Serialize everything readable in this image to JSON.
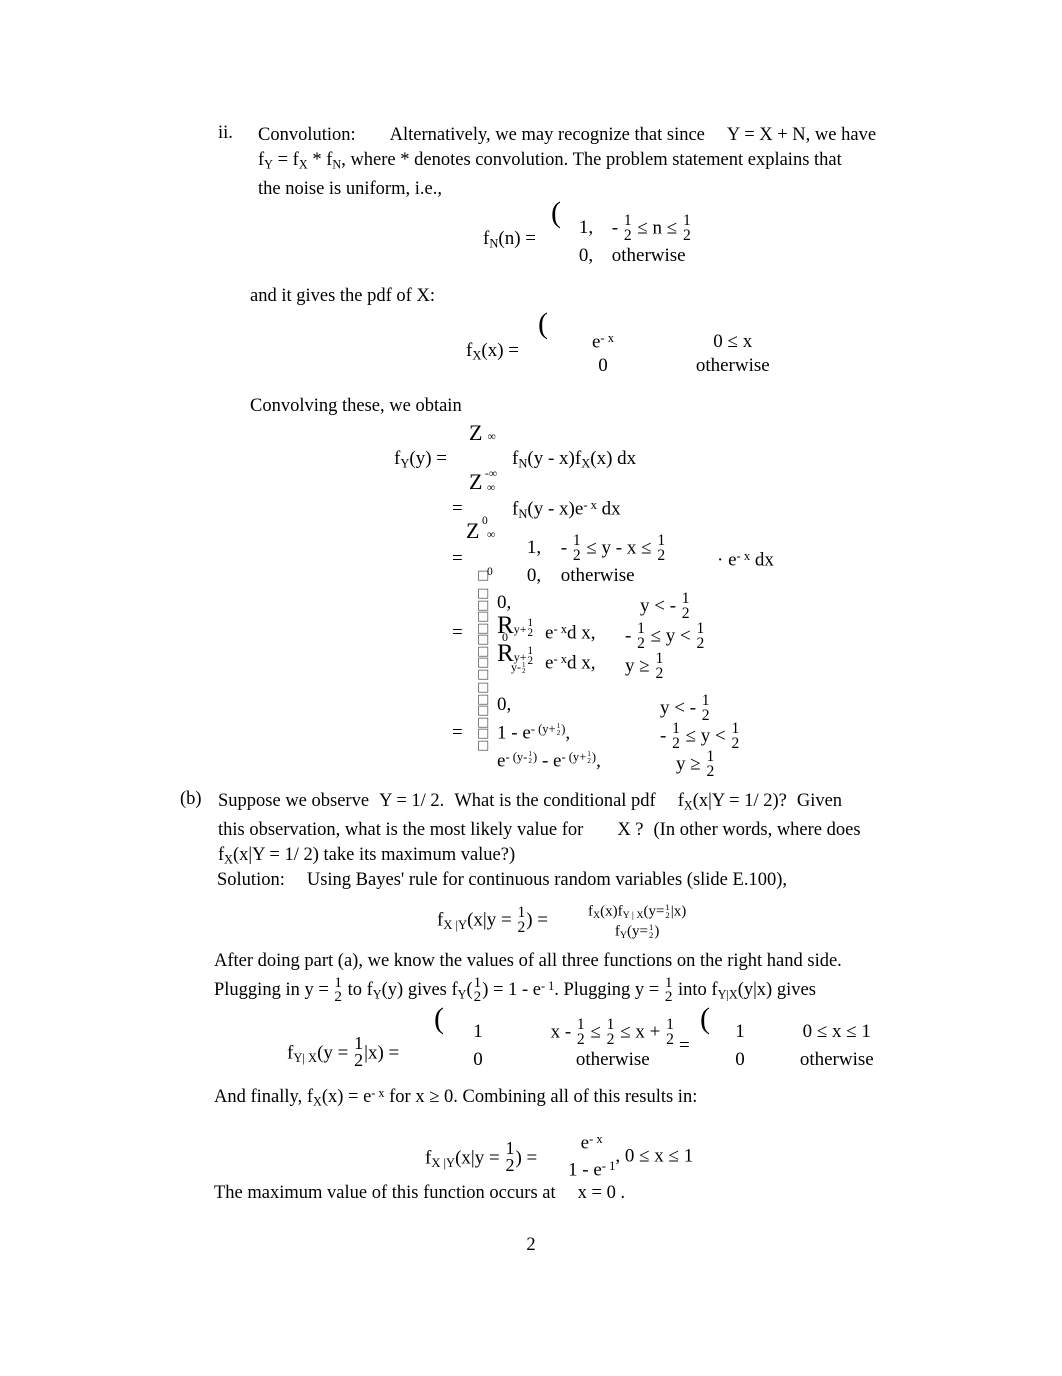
{
  "document": {
    "page_number": "2",
    "item_ii": {
      "marker": "ii.",
      "title": "Convolution:",
      "para": {
        "seg1": "Alternatively, we may recognize that since",
        "eq_Y": "Y = X + N",
        "seg2": ", we have",
        "f_Y": "f",
        "f_Y_sub": "Y",
        "eq_mid": "= f",
        "fX_sub": "X",
        "star": "* f",
        "fN_sub": "N",
        "seg3": ", where * denotes convolution. The problem statement explains that",
        "seg4": "the noise is uniform, i.e.,"
      }
    },
    "eq_fN": {
      "lhs_f": "f",
      "lhs_sub": "N",
      "lhs_arg": "(n) =",
      "brace": "(",
      "row1_val": "1,",
      "row1_cond_pre": "-",
      "row1_frac_n": "1",
      "row1_frac_d": "2",
      "row1_cond_mid": "≤ n ≤",
      "row1_frac2_n": "1",
      "row1_frac2_d": "2",
      "row2_val": "0,",
      "row2_cond": "otherwise"
    },
    "line_pdf_x": {
      "text_pre": "and it gives the pdf of",
      "var": "X",
      "colon": ":"
    },
    "eq_fX": {
      "lhs_f": "f",
      "lhs_sub": "X",
      "lhs_arg": "(x) =",
      "brace": "(",
      "row1_val_e": "e",
      "row1_val_exp": "- x",
      "row1_cond": "0 ≤ x",
      "row2_val": "0",
      "row2_cond": "otherwise"
    },
    "line_convolving": "Convolving these, we obtain",
    "eq_convolution": {
      "lhs_f": "f",
      "lhs_sub": "Y",
      "lhs_arg": "(y) =",
      "int_glyph": "Z",
      "l1_upper": "∞",
      "l1_lower": "-∞",
      "l1_body_f": "f",
      "l1_body_sub": "N",
      "l1_body_rest": "(y -  x)f",
      "l1_body_sub2": "X",
      "l1_body_tail": "(x) dx",
      "eq2": "=",
      "l2_upper": "∞",
      "l2_lower": "0",
      "l2_body_f": "f",
      "l2_body_sub": "N",
      "l2_body_rest": "(y -  x)e",
      "l2_body_exp": "- x",
      "l2_body_tail": "dx",
      "eq3": "=",
      "l3_upper": "∞",
      "l3_lower": "0",
      "l3_brace": "(",
      "l3_row1_val": "1,",
      "l3_row1_pre": "-",
      "l3_row1_fn": "1",
      "l3_row1_fd": "2",
      "l3_row1_mid": "≤ y -  x ≤",
      "l3_row1_f2n": "1",
      "l3_row1_f2d": "2",
      "l3_row2_val": "0,",
      "l3_row2_cond": "otherwise",
      "l3_tail_dot": "·  e",
      "l3_tail_exp": "- x",
      "l3_tail": "dx"
    },
    "eq_piecewise_int": {
      "eq": "=",
      "r1_val": "0,",
      "r1_cond_pre": "y < -",
      "r1_fn": "1",
      "r1_fd": "2",
      "r2_int": "R",
      "r2_up_y": "y+",
      "r2_up_fn": "1",
      "r2_up_fd": "2",
      "r2_low": "0",
      "r2_body_e": "e",
      "r2_body_exp": "- x",
      "r2_body_dx": "d x,",
      "r2_cond_pre": "-",
      "r2_cond_fn": "1",
      "r2_cond_fd": "2",
      "r2_cond_mid": "≤ y <",
      "r2_cond_f2n": "1",
      "r2_cond_f2d": "2",
      "r3_int": "R",
      "r3_up_y": "y+",
      "r3_up_fn": "1",
      "r3_up_fd": "2",
      "r3_low_y": "y-",
      "r3_low_fn": "1",
      "r3_low_fd": "2",
      "r3_body_e": "e",
      "r3_body_exp": "- x",
      "r3_body_dx": "d x,",
      "r3_cond_pre": "y ≥",
      "r3_cond_fn": "1",
      "r3_cond_fd": "2"
    },
    "eq_piecewise_final": {
      "eq": "=",
      "r1_val": "0,",
      "r1_cond_pre": "y < -",
      "r1_fn": "1",
      "r1_fd": "2",
      "r2_val_pre": "1 -  e",
      "r2_exp_open": "- (y+",
      "r2_exp_fn": "1",
      "r2_exp_fd": "2",
      "r2_exp_close": ")",
      "r2_comma": ",",
      "r2_cond_pre": "-",
      "r2_cond_fn": "1",
      "r2_cond_fd": "2",
      "r2_cond_mid": "≤ y <",
      "r2_cond_f2n": "1",
      "r2_cond_f2d": "2",
      "r3_val_e1": "e",
      "r3_e1_open": "- (y-",
      "r3_e1_fn": "1",
      "r3_e1_fd": "2",
      "r3_e1_close": ")",
      "r3_minus": "-",
      "r3_val_e2": "e",
      "r3_e2_open": "- (y+",
      "r3_e2_fn": "1",
      "r3_e2_fd": "2",
      "r3_e2_close": ")",
      "r3_comma": ",",
      "r3_cond_pre": "y ≥",
      "r3_cond_fn": "1",
      "r3_cond_fd": "2"
    },
    "item_b": {
      "marker": "(b)",
      "l1_a": "Suppose we observe",
      "l1_Y": "Y = 1/ 2.",
      "l1_b": "What is the conditional pdf",
      "l1_f": "f",
      "l1_f_sub": "X",
      "l1_f_arg": "(x|Y = 1/ 2)?",
      "l1_c": "Given",
      "l2_a": "this observation, what is the most likely value for",
      "l2_X": "X ?",
      "l2_b": "(In other words, where does",
      "l3_f": "f",
      "l3_f_sub": "X",
      "l3_f_arg": "(x|Y = 1/ 2) take its maximum value?)"
    },
    "solution": {
      "label": "Solution:",
      "text": "Using Bayes' rule for continuous random variables (slide E.100),"
    },
    "eq_bayes": {
      "lhs_f": "f",
      "lhs_sub": "X |Y",
      "lhs_arg_pre": "(x|y =",
      "lhs_fn": "1",
      "lhs_fd": "2",
      "lhs_arg_post": ") =",
      "num_f1": "f",
      "num_f1_sub": "X",
      "num_f1_arg": "(x)f",
      "num_f2_sub": "Y | X",
      "num_f2_arg_pre": "(y=",
      "num_fn": "1",
      "num_fd": "2",
      "num_arg_post": "|x)",
      "den_f": "f",
      "den_sub": "Y",
      "den_arg_pre": "(y=",
      "den_fn": "1",
      "den_fd": "2",
      "den_arg_post": ")"
    },
    "para_after": {
      "l1": "After doing part (a), we know the values of all three functions on the right hand side.",
      "l2_a": "Plugging in",
      "l2_y": "y =",
      "l2_fn": "1",
      "l2_fd": "2",
      "l2_b": "to f",
      "l2_fY_sub": "Y",
      "l2_c": "(y) gives f",
      "l2_fY2_sub": "Y",
      "l2_d": "(",
      "l2_f2n": "1",
      "l2_f2d": "2",
      "l2_e": ") = 1 -  e",
      "l2_exp": "- 1",
      "l2_f": ". Plugging",
      "l2_y2": "y =",
      "l2_f3n": "1",
      "l2_f3d": "2",
      "l2_g": "into f",
      "l2_fYX_sub": "Y|X",
      "l2_h": "(y|x) gives"
    },
    "eq_fYX": {
      "lhs_f": "f",
      "lhs_sub": "Y| X",
      "lhs_pre": "(y =",
      "lhs_fn": "1",
      "lhs_fd": "2",
      "lhs_post": "|x) =",
      "brace1": "(",
      "a_row1_val": "1",
      "a_row1_cond_pre": "x -",
      "a_row1_fn": "1",
      "a_row1_fd": "2",
      "a_row1_mid": "≤",
      "a_row1_f2n": "1",
      "a_row1_f2d": "2",
      "a_row1_mid2": "≤ x +",
      "a_row1_f3n": "1",
      "a_row1_f3d": "2",
      "a_row2_val": "0",
      "a_row2_cond": "otherwise",
      "equals": "=",
      "brace2": "(",
      "b_row1_val": "1",
      "b_row1_cond": "0 ≤  x ≤ 1",
      "b_row2_val": "0",
      "b_row2_cond": "otherwise"
    },
    "line_finally": {
      "a": "And finally,",
      "f": "f",
      "f_sub": "X",
      "f_arg": "(x) =  e",
      "exp": "- x",
      "b": "for  x ≥  0. Combining all of this results in:"
    },
    "eq_final": {
      "lhs_f": "f",
      "lhs_sub": "X |Y",
      "lhs_pre": "(x|y =",
      "lhs_fn": "1",
      "lhs_fd": "2",
      "lhs_post": ") =",
      "num_e": "e",
      "num_exp": "- x",
      "den_pre": "1 -  e",
      "den_exp": "- 1",
      "tail": ", 0 ≤  x ≤  1"
    },
    "line_max": {
      "a": "The maximum value of this function occurs at",
      "b": "x = 0 ."
    }
  }
}
